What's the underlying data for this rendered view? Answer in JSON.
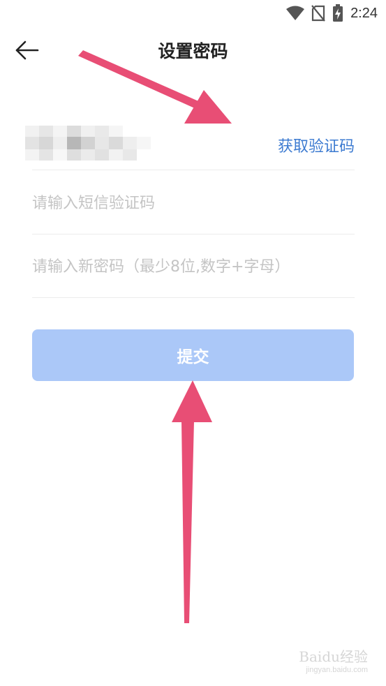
{
  "status_bar": {
    "time": "2:24",
    "icons": [
      "wifi-icon",
      "no-sim-icon",
      "battery-charging-icon"
    ]
  },
  "header": {
    "back_icon": "arrow-left-icon",
    "title": "设置密码"
  },
  "form": {
    "phone_masked": true,
    "get_code_label": "获取验证码",
    "sms_code_placeholder": "请输入短信验证码",
    "password_placeholder": "请输入新密码（最少8位,数字+字母）",
    "submit_label": "提交"
  },
  "colors": {
    "link": "#3d7bd1",
    "submit_bg": "#abc8f8",
    "annotation_arrow": "#e84e75"
  },
  "watermark": {
    "brand": "Baidu经验",
    "url": "jingyan.baidu.com"
  }
}
